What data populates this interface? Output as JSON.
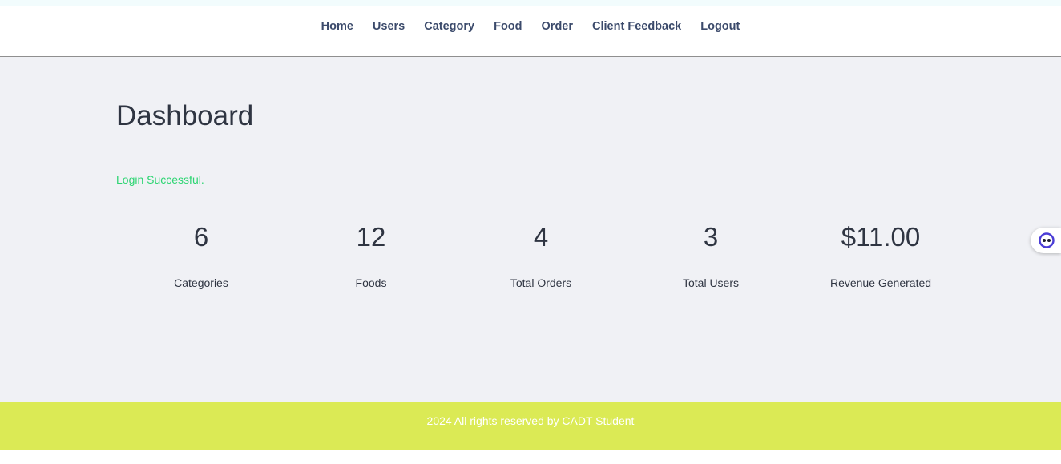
{
  "nav": {
    "items": [
      "Home",
      "Users",
      "Category",
      "Food",
      "Order",
      "Client Feedback",
      "Logout"
    ]
  },
  "main": {
    "title": "Dashboard",
    "message": "Login Successful.",
    "stats": [
      {
        "value": "6",
        "label": "Categories"
      },
      {
        "value": "12",
        "label": "Foods"
      },
      {
        "value": "4",
        "label": "Total Orders"
      },
      {
        "value": "3",
        "label": "Total Users"
      },
      {
        "value": "$11.00",
        "label": "Revenue Generated"
      }
    ]
  },
  "footer": {
    "text": "2024 All rights reserved by CADT Student"
  },
  "colors": {
    "nav_text": "#3b4a6b",
    "content_bg": "#f0f1f5",
    "success": "#2ed573",
    "footer_bg": "#dbea55"
  },
  "icons": {
    "floating_widget": "assistant-icon"
  }
}
